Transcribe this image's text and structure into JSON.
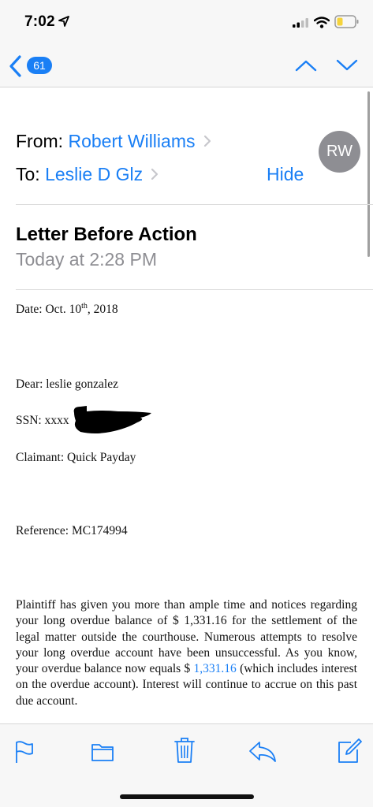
{
  "status_bar": {
    "time": "7:02"
  },
  "nav": {
    "unread_count": "61"
  },
  "header": {
    "from_label": "From:",
    "from_name": "Robert Williams",
    "to_label": "To:",
    "to_name": "Leslie D Glz",
    "hide_label": "Hide",
    "avatar_initials": "RW"
  },
  "message": {
    "subject": "Letter Before Action",
    "sent_time": "Today at 2:28 PM"
  },
  "letter": {
    "date_prefix": "Date: Oct. 10",
    "date_sup": "th",
    "date_suffix": ", 2018",
    "dear": "Dear: leslie gonzalez",
    "ssn": "SSN: xxxx",
    "claimant": "Claimant: Quick Payday",
    "reference": "Reference: MC174994",
    "para_part1": "Plaintiff has given you more than ample time and notices regarding your long overdue balance of $ 1,331.16 for the settlement of the legal matter outside the courthouse. Numerous attempts to resolve your long overdue account have been unsuccessful. As you know, your overdue balance now equals $ ",
    "para_link": "1,331.16",
    "para_part2": " (which includes interest on the overdue account). Interest will continue to accrue on this past due account."
  },
  "icons": {
    "back": "chevron-left-icon",
    "up": "chevron-up-icon",
    "down": "chevron-down-icon",
    "flag": "flag-icon",
    "folder": "folder-icon",
    "trash": "trash-icon",
    "reply": "reply-icon",
    "compose": "compose-icon"
  },
  "colors": {
    "accent": "#1a7ff5",
    "secondary_text": "#8e8e93",
    "battery_low": "#f5d33b"
  }
}
